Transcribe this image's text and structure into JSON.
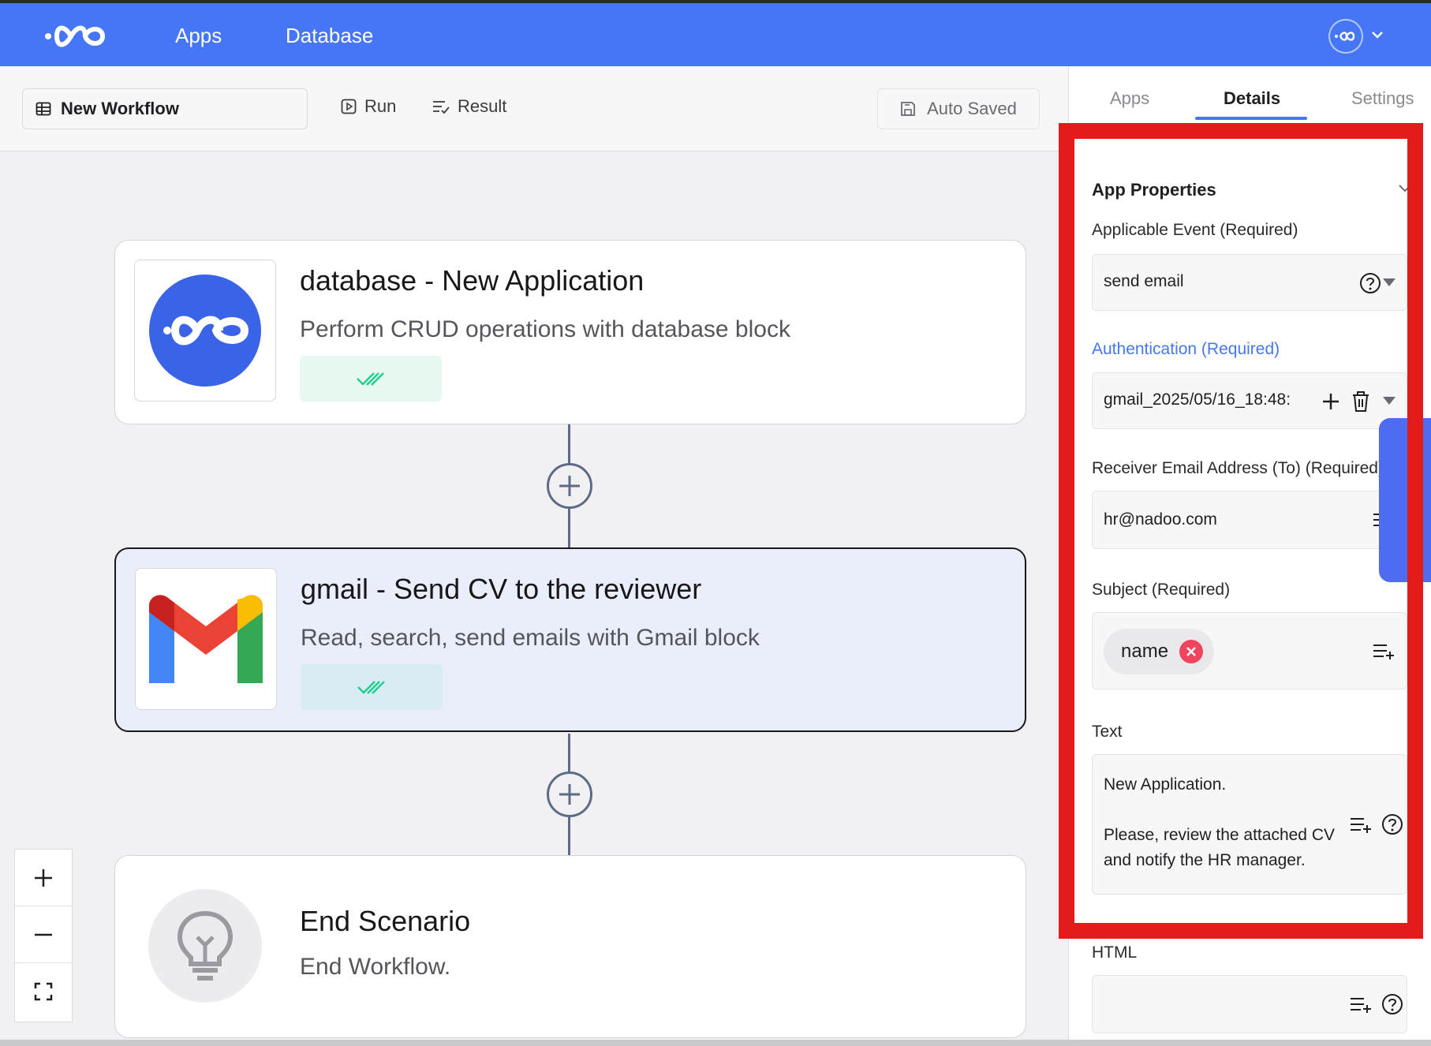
{
  "topbar": {
    "nav": [
      "Apps",
      "Database"
    ],
    "brand_color": "#4576f6"
  },
  "toolbar": {
    "workflow_name": "New Workflow",
    "run_label": "Run",
    "result_label": "Result",
    "auto_saved_label": "Auto Saved"
  },
  "nodes": [
    {
      "title": "database - New Application",
      "description": "Perform CRUD operations with database block",
      "icon": "database-logo-icon",
      "status": "double-check-icon"
    },
    {
      "title": "gmail - Send CV to the reviewer",
      "description": "Read, search, send emails with Gmail block",
      "icon": "gmail-logo-icon",
      "status": "double-check-icon",
      "selected": true
    },
    {
      "title": "End Scenario",
      "description": "End Workflow.",
      "icon": "lightbulb-icon"
    }
  ],
  "zoom_controls": [
    "zoom-in-icon",
    "zoom-out-icon",
    "fit-view-icon"
  ],
  "panel": {
    "tabs": [
      "Apps",
      "Details",
      "Settings"
    ],
    "active_tab": "Details",
    "section_title": "App Properties",
    "fields": {
      "event_label": "Applicable Event (Required)",
      "event_value": "send email",
      "auth_label": "Authentication (Required)",
      "auth_value": "gmail_2025/05/16_18:48:",
      "to_label": "Receiver Email Address (To) (Required)",
      "to_value": "hr@nadoo.com",
      "subject_label": "Subject (Required)",
      "subject_chip": "name",
      "text_label": "Text",
      "text_value": "New Application.\n\nPlease, review the attached CV and notify the HR manager.",
      "html_label": "HTML",
      "html_value": ""
    }
  },
  "colors": {
    "highlight_border": "#e31b1b",
    "accent": "#4576f6",
    "chip_remove": "#f0435e",
    "check_green": "#1fcf8f"
  }
}
